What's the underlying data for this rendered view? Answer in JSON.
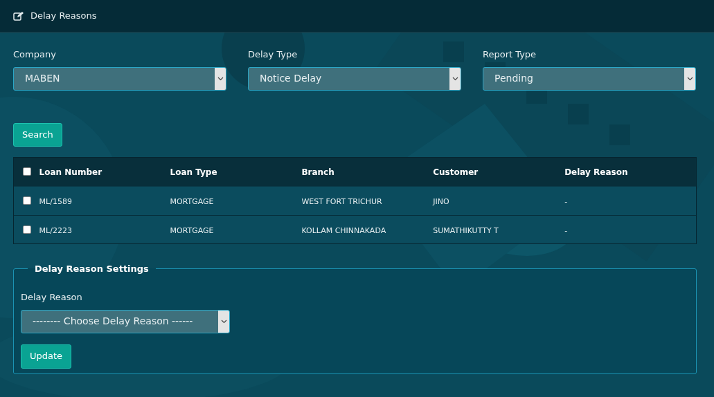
{
  "header": {
    "title": "Delay Reasons"
  },
  "filters": [
    {
      "label": "Company",
      "value": "MABEN"
    },
    {
      "label": "Delay Type",
      "value": "Notice Delay"
    },
    {
      "label": "Report Type",
      "value": "Pending"
    }
  ],
  "search_button": "Search",
  "table": {
    "select_all": {
      "checked": false
    },
    "columns": [
      "Loan Number",
      "Loan Type",
      "Branch",
      "Customer",
      "Delay Reason"
    ],
    "rows": [
      {
        "checked": false,
        "cells": [
          "ML/1589",
          "MORTGAGE",
          "WEST FORT TRICHUR",
          "JINO",
          "-"
        ]
      },
      {
        "checked": false,
        "cells": [
          "ML/2223",
          "MORTGAGE",
          "KOLLAM CHINNAKADA",
          "SUMATHIKUTTY T",
          "-"
        ]
      }
    ]
  },
  "settings": {
    "legend": "Delay Reason Settings",
    "label": "Delay Reason",
    "value": "-------- Choose Delay Reason ------",
    "button": "Update"
  }
}
